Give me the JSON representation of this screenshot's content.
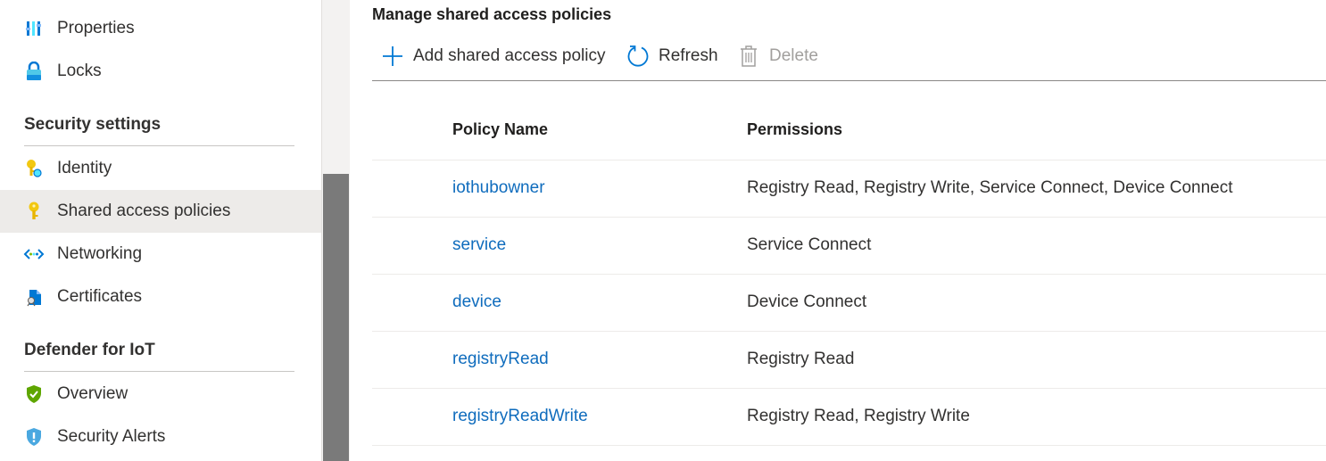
{
  "sidebar": {
    "top_items": [
      {
        "label": "Properties",
        "icon": "properties-icon"
      },
      {
        "label": "Locks",
        "icon": "lock-icon"
      }
    ],
    "sections": [
      {
        "header": "Security settings",
        "items": [
          {
            "label": "Identity",
            "icon": "identity-key-icon"
          },
          {
            "label": "Shared access policies",
            "icon": "key-icon",
            "selected": true
          },
          {
            "label": "Networking",
            "icon": "networking-icon"
          },
          {
            "label": "Certificates",
            "icon": "certificate-icon"
          }
        ]
      },
      {
        "header": "Defender for IoT",
        "items": [
          {
            "label": "Overview",
            "icon": "shield-check-icon"
          },
          {
            "label": "Security Alerts",
            "icon": "shield-alert-icon"
          }
        ]
      }
    ]
  },
  "main": {
    "title": "Manage shared access policies",
    "toolbar": {
      "add_label": "Add shared access policy",
      "refresh_label": "Refresh",
      "delete_label": "Delete"
    },
    "table": {
      "columns": [
        "Policy Name",
        "Permissions"
      ],
      "rows": [
        {
          "name": "iothubowner",
          "permissions": "Registry Read, Registry Write, Service Connect, Device Connect"
        },
        {
          "name": "service",
          "permissions": "Service Connect"
        },
        {
          "name": "device",
          "permissions": "Device Connect"
        },
        {
          "name": "registryRead",
          "permissions": "Registry Read"
        },
        {
          "name": "registryReadWrite",
          "permissions": "Registry Read, Registry Write"
        }
      ]
    }
  },
  "colors": {
    "accent": "#0078d4",
    "link": "#0f6cbd",
    "selected_bg": "#edebe9",
    "scroll_thumb": "#7a7a7a"
  }
}
